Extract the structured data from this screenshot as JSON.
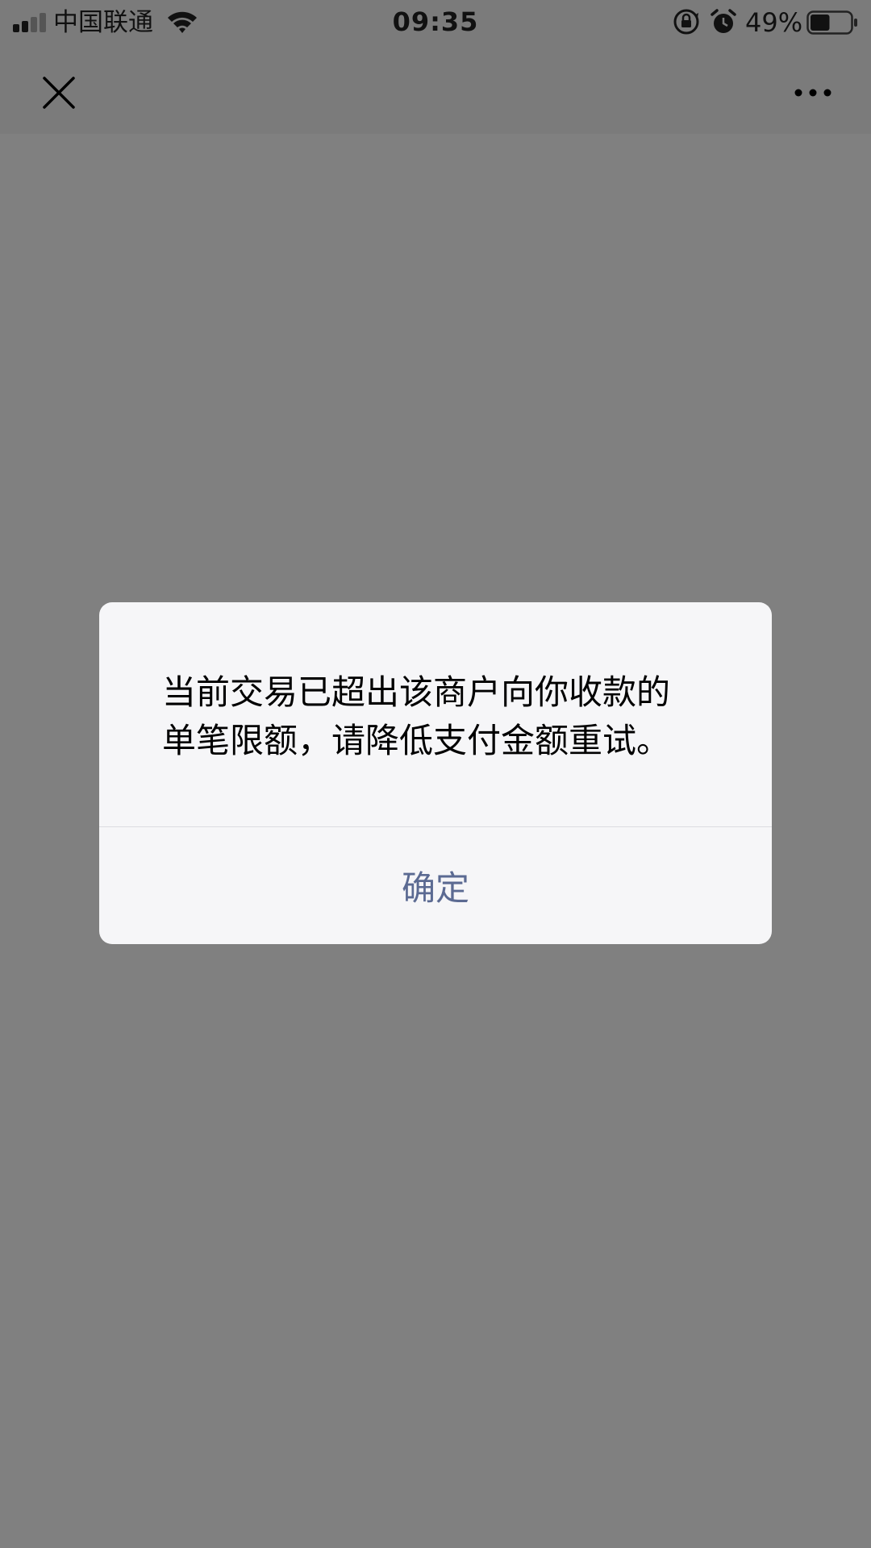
{
  "status_bar": {
    "carrier": "中国联通",
    "time": "09:35",
    "battery_percent": "49%",
    "battery_level": 0.49,
    "signal_bars_active": 2,
    "signal_bars_total": 4,
    "icons": [
      "signal-icon",
      "wifi-icon",
      "rotation-lock-icon",
      "alarm-icon",
      "battery-icon"
    ]
  },
  "nav_bar": {
    "close_icon": "close-icon",
    "more_icon": "more-icon"
  },
  "dialog": {
    "message": "当前交易已超出该商户向你收款的\n单笔限额，请降低支付金额重试。",
    "confirm_label": "确定"
  },
  "colors": {
    "overlay": "#808080",
    "dialog_bg": "#f6f6f8",
    "button_text": "#5b6a92"
  }
}
